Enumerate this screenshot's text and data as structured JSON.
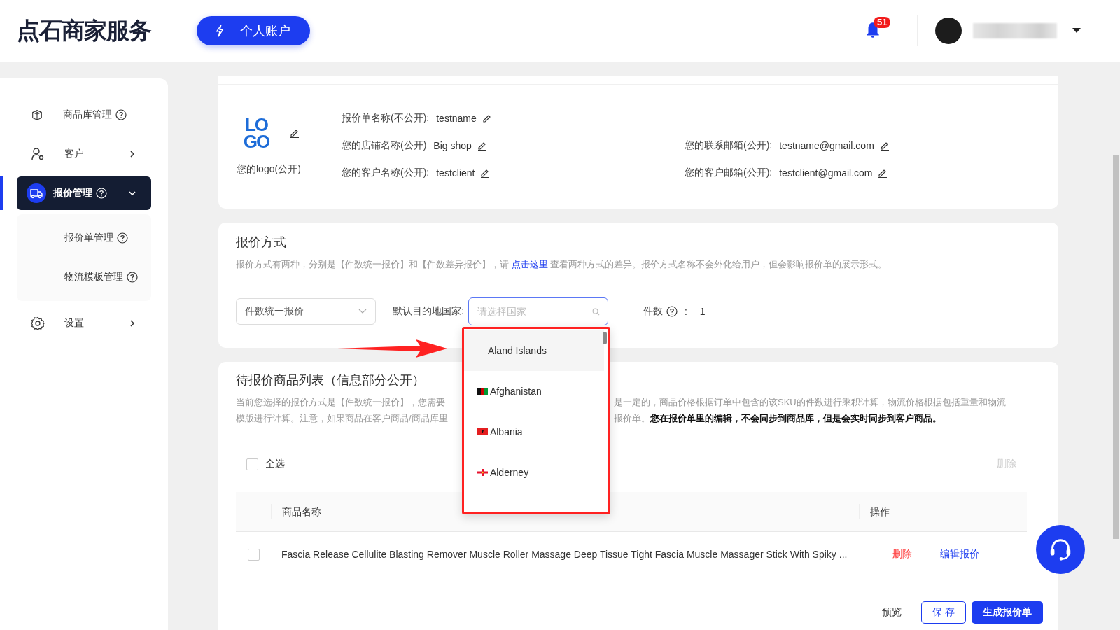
{
  "header": {
    "brand": "点石商家服务",
    "account_button": "个人账户",
    "notification_count": "51"
  },
  "sidebar": {
    "items": [
      {
        "label": "商品库管理",
        "kind": "link",
        "help": true,
        "expanded": false,
        "selected": false
      },
      {
        "label": "客户",
        "kind": "group",
        "help": false,
        "expanded": false,
        "selected": false
      },
      {
        "label": "报价管理",
        "kind": "group",
        "help": true,
        "expanded": true,
        "selected": true,
        "children": [
          {
            "label": "报价单管理",
            "help": true
          },
          {
            "label": "物流模板管理",
            "help": true
          }
        ]
      },
      {
        "label": "设置",
        "kind": "group",
        "help": false,
        "expanded": false,
        "selected": false
      }
    ]
  },
  "quote_info": {
    "logo_text": [
      "LO",
      "GO"
    ],
    "logo_label": "您的logo(公开)",
    "left_fields": [
      {
        "label": "报价单名称(不公开):",
        "value": "testname"
      },
      {
        "label": "您的店铺名称(公开)",
        "value": "Big shop"
      },
      {
        "label": "您的客户名称(公开):",
        "value": "testclient"
      }
    ],
    "right_fields": [
      {
        "label": "您的联系邮箱(公开):",
        "value": "testname@gmail.com"
      },
      {
        "label": "您的客户邮箱(公开):",
        "value": "testclient@gmail.com"
      }
    ]
  },
  "pricing": {
    "title": "报价方式",
    "description_before": "报价方式有两种，分别是【件数统一报价】和【件数差异报价】，请",
    "description_link": "点击这里",
    "description_after": "查看两种方式的差异。报价方式名称不会外化给用户，但会影响报价单的展示形式。",
    "method_select": "件数统一报价",
    "country_label": "默认目的地国家:",
    "country_placeholder": "请选择国家",
    "quantity_label": "件数",
    "quantity_colon": ":",
    "quantity_value": "1",
    "country_options": [
      {
        "name": "Aland Islands",
        "selected": true
      },
      {
        "name": "Afghanistan",
        "selected": false
      },
      {
        "name": "Albania",
        "selected": false
      },
      {
        "name": "Alderney",
        "selected": false
      }
    ]
  },
  "products": {
    "title": "待报价商品列表（信息部分公开）",
    "description_lines": [
      {
        "left": "当前您选择的报价方式是【件数统一报价】，您需要",
        "right": "是一定的，商品价格根据订单中包含的该SKU的件数进行乘积计算，物流价格根据包括重量和物流"
      },
      {
        "left": "模版进行计算。注意，如果商品在客户商品/商品库里",
        "right": "报价单。**您在报价单里的编辑，不会同步到商品库，但是会实时同步到客户商品。**"
      }
    ],
    "select_all": {
      "label": "全选",
      "checked": false
    },
    "bulk_delete": {
      "label": "删除",
      "disabled": true
    },
    "columns": [
      "商品名称",
      "操作"
    ],
    "rows": [
      {
        "checked": false,
        "name": "Fascia Release Cellulite Blasting Remover Muscle Roller Massage Deep Tissue Tight Fascia Muscle Massager Stick With Spiky ...",
        "delete": "删除",
        "edit": "编辑报价"
      }
    ],
    "footer": {
      "preview": "预览",
      "save": "保 存",
      "generate": "生成报价单"
    }
  }
}
